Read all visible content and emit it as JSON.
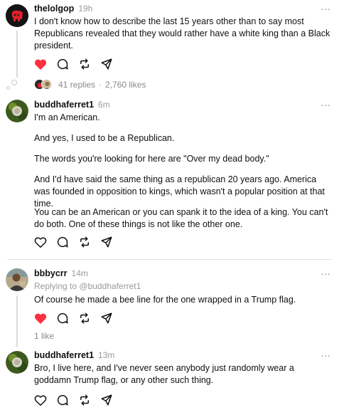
{
  "more_glyph": "···",
  "posts": [
    {
      "username": "thelolgop",
      "time": "19h",
      "paragraphs": [
        "I don't know how to describe the last 15 years other than to say most Republicans revealed that they would rather have a white king than a Black president."
      ],
      "liked": true,
      "replies_text": "41 replies",
      "likes_text": "2,760 likes",
      "separator": "·"
    },
    {
      "username": "buddhaferret1",
      "time": "6m",
      "paragraphs": [
        "I'm an American.",
        "And yes, I used to be a Republican.",
        "The words you're looking for here are \"Over my dead body.\"",
        "And I'd have said the same thing as a republican 20 years ago. America was founded in opposition to kings, which wasn't a popular position at that time.",
        "You can be an American or you can spank it to the idea of a king. You can't do both. One of these things is not like the other one."
      ],
      "liked": false
    },
    {
      "username": "bbbycrr",
      "time": "14m",
      "replying_to": "Replying to @buddhaferret1",
      "paragraphs": [
        "Of course he made a bee line for the one wrapped in a Trump flag."
      ],
      "liked": true,
      "likes_text": "1 like"
    },
    {
      "username": "buddhaferret1",
      "time": "13m",
      "paragraphs": [
        "Bro, I live here, and I've never seen anybody just randomly wear a goddamn Trump flag, or any other such thing."
      ],
      "liked": false
    }
  ],
  "colors": {
    "like_red": "#ff3040",
    "text": "#101010",
    "muted": "#9a9a9a",
    "divider": "#e2e2e2"
  }
}
